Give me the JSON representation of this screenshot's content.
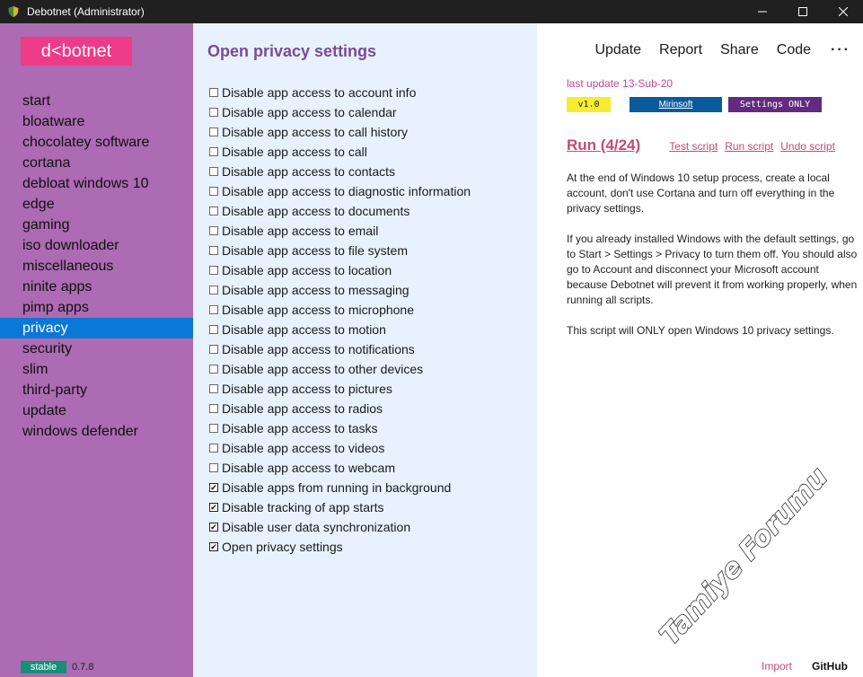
{
  "window": {
    "title": "Debotnet (Administrator)",
    "controls": {
      "minimize": "—",
      "maximize": "☐",
      "close": "✕"
    }
  },
  "sidebar": {
    "logo": "d<botnet",
    "items": [
      {
        "label": "start"
      },
      {
        "label": "bloatware"
      },
      {
        "label": "chocolatey software"
      },
      {
        "label": "cortana"
      },
      {
        "label": "debloat windows 10"
      },
      {
        "label": "edge"
      },
      {
        "label": "gaming"
      },
      {
        "label": "iso downloader"
      },
      {
        "label": "miscellaneous"
      },
      {
        "label": "ninite apps"
      },
      {
        "label": "pimp apps"
      },
      {
        "label": "privacy",
        "active": true
      },
      {
        "label": "security"
      },
      {
        "label": "slim"
      },
      {
        "label": "third-party"
      },
      {
        "label": "update"
      },
      {
        "label": "windows defender"
      }
    ],
    "channel": "stable",
    "version": "0.7.8"
  },
  "middle": {
    "title": "Open privacy settings",
    "items": [
      {
        "label": "Disable app access to account info",
        "checked": false
      },
      {
        "label": "Disable app access to calendar",
        "checked": false
      },
      {
        "label": "Disable app access to call history",
        "checked": false
      },
      {
        "label": "Disable app access to call",
        "checked": false
      },
      {
        "label": "Disable app access to contacts",
        "checked": false
      },
      {
        "label": "Disable app access to diagnostic information",
        "checked": false
      },
      {
        "label": "Disable app access to documents",
        "checked": false
      },
      {
        "label": "Disable app access to email",
        "checked": false
      },
      {
        "label": "Disable app access to file system",
        "checked": false
      },
      {
        "label": "Disable app access to location",
        "checked": false
      },
      {
        "label": "Disable app access to messaging",
        "checked": false
      },
      {
        "label": "Disable app access to microphone",
        "checked": false
      },
      {
        "label": "Disable app access to motion",
        "checked": false
      },
      {
        "label": "Disable app access to notifications",
        "checked": false
      },
      {
        "label": "Disable app access to other devices",
        "checked": false
      },
      {
        "label": "Disable app access to pictures",
        "checked": false
      },
      {
        "label": "Disable app access to radios",
        "checked": false
      },
      {
        "label": "Disable app access to tasks",
        "checked": false
      },
      {
        "label": "Disable app access to videos",
        "checked": false
      },
      {
        "label": "Disable app access to webcam",
        "checked": false
      },
      {
        "label": "Disable apps from running in background",
        "checked": true
      },
      {
        "label": "Disable tracking of app starts",
        "checked": true
      },
      {
        "label": "Disable user data synchronization",
        "checked": true
      },
      {
        "label": "Open privacy settings",
        "checked": true
      }
    ]
  },
  "right": {
    "menu": {
      "update": "Update",
      "report": "Report",
      "share": "Share",
      "code": "Code",
      "more": "···"
    },
    "last_update": "last update 13-Sub-20",
    "badges": {
      "version": "v1.0",
      "org": "Mirinsoft",
      "mode": "Settings ONLY"
    },
    "run": {
      "title": "Run (4/24)",
      "test": "Test script",
      "run": "Run script",
      "undo": "Undo script"
    },
    "description": [
      "At the end of Windows 10 setup process, create a local account, don't use Cortana and turn off everything in the privacy settings.",
      "If you already installed Windows with the default settings, go to Start > Settings > Privacy to turn them off. You should also go to Account and disconnect your Microsoft account because Debotnet will prevent it from working properly, when running all scripts.",
      "This script will ONLY open Windows 10 privacy settings."
    ],
    "footer": {
      "import": "Import",
      "github": "GitHub"
    }
  },
  "watermark": "Tamiye Forumu",
  "colors": {
    "sidebar_bg": "#ac6bb2",
    "logo_bg": "#ee3a87",
    "active_nav": "#0a78d7",
    "middle_bg": "#e7f2fe",
    "accent_link": "#c44a76",
    "stable_badge": "#168f79"
  }
}
